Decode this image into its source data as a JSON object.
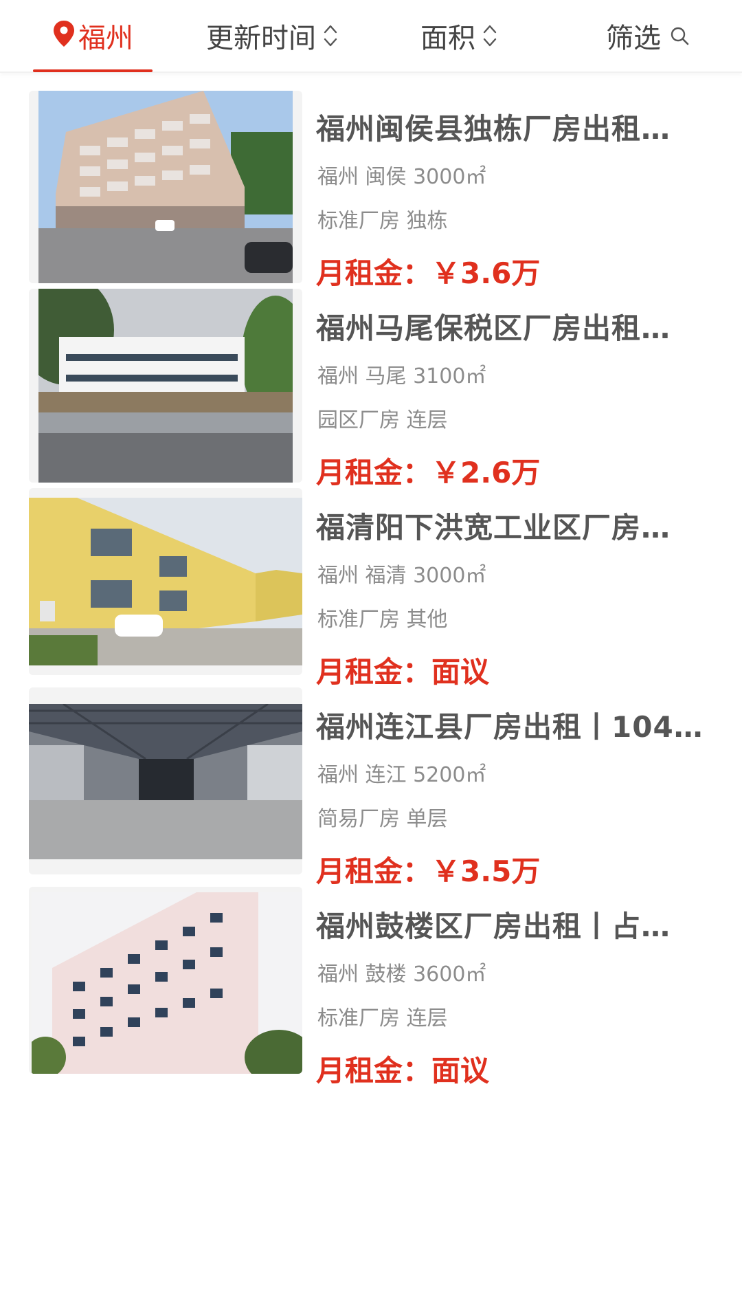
{
  "filter_bar": {
    "city": "福州",
    "sort_time": "更新时间",
    "sort_area": "面积",
    "filter": "筛选"
  },
  "listings": [
    {
      "title": "福州闽侯县独栋厂房出租…",
      "meta": "福州 闽侯 3000㎡",
      "tags": "标准厂房 独栋",
      "rent": "月租金：￥3.6万"
    },
    {
      "title": "福州马尾保税区厂房出租…",
      "meta": "福州 马尾 3100㎡",
      "tags": "园区厂房 连层",
      "rent": "月租金：￥2.6万"
    },
    {
      "title": "福清阳下洪宽工业区厂房…",
      "meta": "福州 福清 3000㎡",
      "tags": "标准厂房 其他",
      "rent": "月租金：面议"
    },
    {
      "title": "福州连江县厂房出租丨104…",
      "meta": "福州 连江 5200㎡",
      "tags": "简易厂房 单层",
      "rent": "月租金：￥3.5万"
    },
    {
      "title": "福州鼓楼区厂房出租丨占…",
      "meta": "福州 鼓楼 3600㎡",
      "tags": "标准厂房 连层",
      "rent": "月租金：面议"
    }
  ],
  "colors": {
    "accent": "#e0301e",
    "title_text": "#555555",
    "meta_text": "#8c8c8c"
  }
}
